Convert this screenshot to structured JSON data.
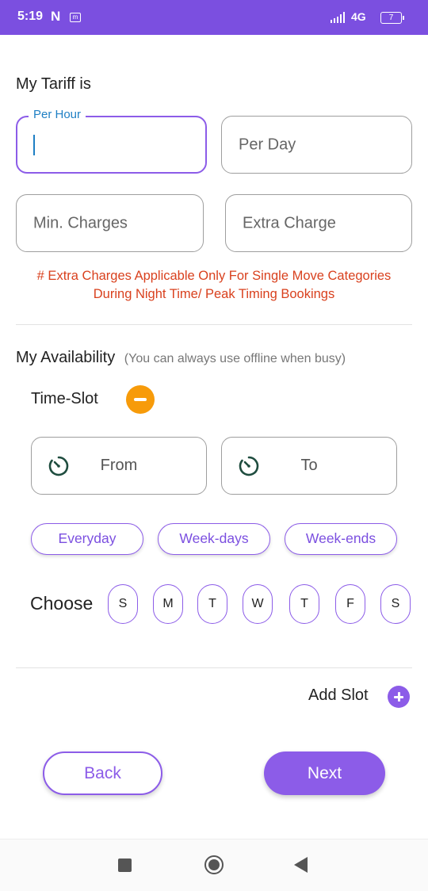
{
  "status_bar": {
    "time": "5:19",
    "notif_n": "N",
    "notif_m": "m",
    "network": "4G",
    "battery": "7"
  },
  "tariff": {
    "title": "My Tariff is",
    "per_hour_label": "Per Hour",
    "per_hour_value": "",
    "per_day_placeholder": "Per Day",
    "min_charges_placeholder": "Min. Charges",
    "extra_charge_placeholder": "Extra Charge",
    "note_line1": "# Extra Charges Applicable Only For Single Move Categories",
    "note_line2": "During Night Time/ Peak Timing Bookings"
  },
  "availability": {
    "title": "My Availability",
    "subtitle": "(You can always use offline when busy)",
    "time_slot_label": "Time-Slot",
    "from_label": "From",
    "to_label": "To",
    "presets": [
      "Everyday",
      "Week-days",
      "Week-ends"
    ],
    "choose_label": "Choose",
    "days": [
      "S",
      "M",
      "T",
      "W",
      "T",
      "F",
      "S"
    ],
    "add_slot_label": "Add Slot"
  },
  "actions": {
    "back_label": "Back",
    "next_label": "Next"
  },
  "colors": {
    "accent": "#8c5ce8",
    "status_bar": "#7b4fe0",
    "warning_text": "#d9411e",
    "minus_button": "#f79b0a",
    "focus_label": "#1e7fc4"
  },
  "icons": {
    "remove_slot": "minus-circle-icon",
    "add_slot": "plus-circle-icon",
    "time": "clock-icon"
  }
}
